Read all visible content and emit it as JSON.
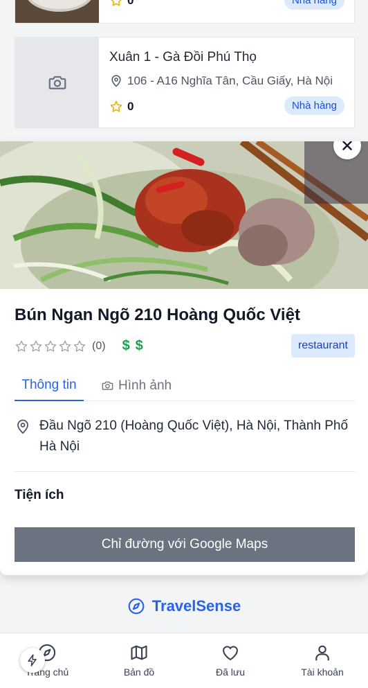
{
  "listing_cards": [
    {
      "rating": "0",
      "category": "Nhà hàng"
    },
    {
      "title": "Xuân 1 - Gà Đồi Phú Thọ",
      "address": "106 - A16 Nghĩa Tân, Cầu Giấy, Hà Nội",
      "rating": "0",
      "category": "Nhà hàng"
    }
  ],
  "detail": {
    "title": "Bún Ngan Ngõ 210 Hoàng Quốc Việt",
    "review_count": "(0)",
    "price_level": "$$",
    "type": "restaurant",
    "tabs": [
      {
        "label": "Thông tin",
        "active": true
      },
      {
        "label": "Hình ảnh",
        "active": false
      }
    ],
    "address": "Đầu Ngõ 210 (Hoàng Quốc Việt), Hà Nội, Thành Phố Hà Nội",
    "amenities_heading": "Tiện ích",
    "directions_button": "Chỉ đường với Google Maps"
  },
  "brand": {
    "name": "TravelSense"
  },
  "bottom_nav": [
    {
      "label": "Trang chủ",
      "icon": "compass-icon"
    },
    {
      "label": "Bản đồ",
      "icon": "map-icon"
    },
    {
      "label": "Đã lưu",
      "icon": "heart-icon"
    },
    {
      "label": "Tài khoản",
      "icon": "user-icon"
    }
  ],
  "colors": {
    "accent": "#2563eb",
    "badge_bg": "#dbeafe",
    "price": "#16a34a",
    "star": "#eab308",
    "button": "#6b7280"
  }
}
